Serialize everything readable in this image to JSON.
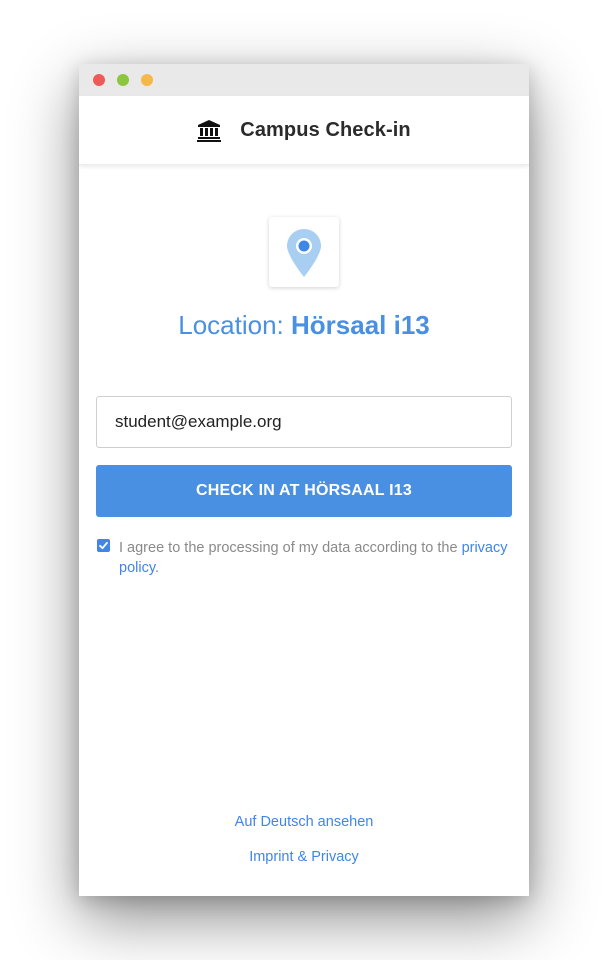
{
  "colors": {
    "accent": "#4a90e2",
    "traffic_close": "#ee5a57",
    "traffic_min": "#8cc63f",
    "traffic_max": "#f6b949"
  },
  "header": {
    "icon": "institution-icon",
    "title": "Campus Check-in"
  },
  "location": {
    "icon": "map-pin-icon",
    "prefix": "Location: ",
    "name": "Hörsaal i13"
  },
  "form": {
    "email_value": "student@example.org",
    "submit_label": "CHECK IN AT HÖRSAAL I13"
  },
  "consent": {
    "checked": true,
    "text": "I agree to the processing of my data according to the ",
    "link_text": "privacy policy",
    "suffix": "."
  },
  "footer": {
    "language_link": "Auf Deutsch ansehen",
    "imprint_link": "Imprint & Privacy"
  }
}
